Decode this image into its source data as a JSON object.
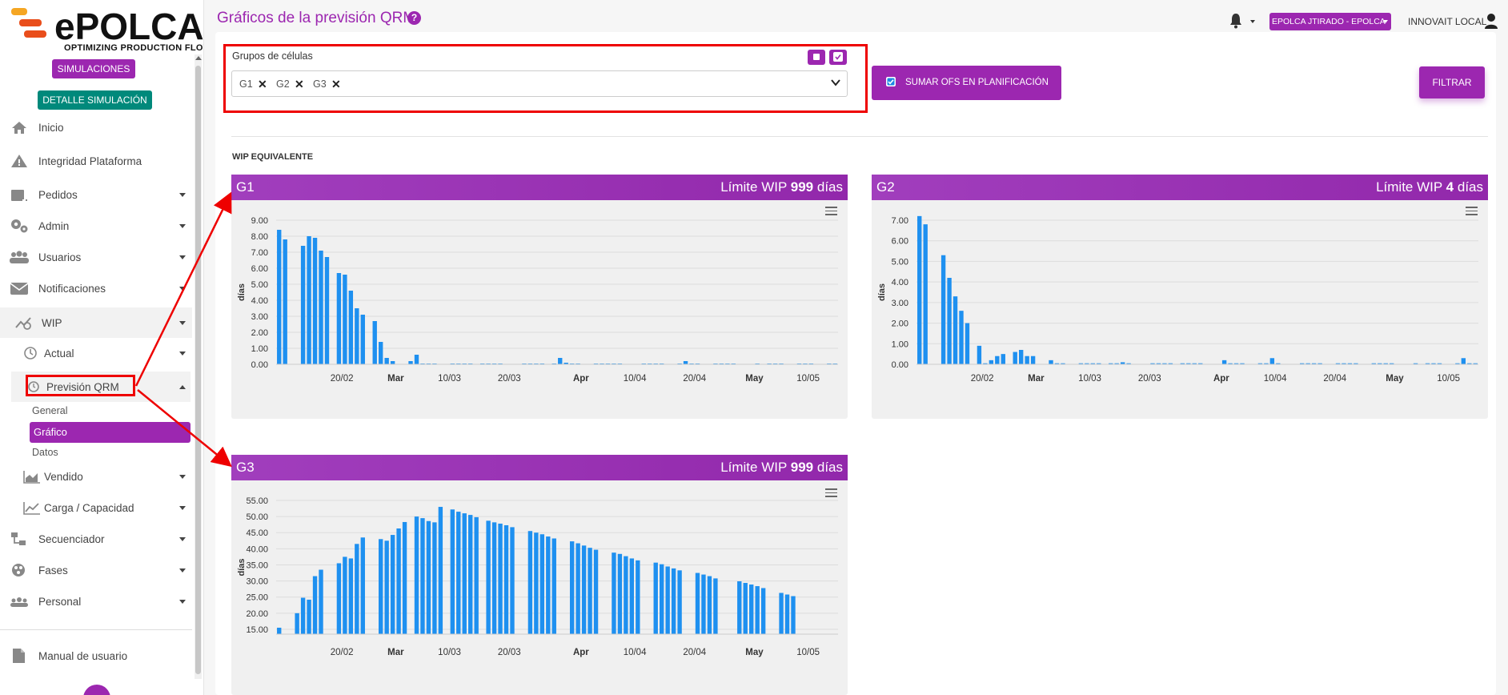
{
  "brand": {
    "name": "ePOLCA",
    "tagline": "OPTIMIZING PRODUCTION FLOW"
  },
  "sidebar": {
    "simulaciones_label": "SIMULACIONES",
    "detalle_label": "DETALLE SIMULACIÓN",
    "items": [
      {
        "label": "Inicio",
        "icon": "home-icon"
      },
      {
        "label": "Integridad Plataforma",
        "icon": "warning-icon"
      },
      {
        "label": "Pedidos",
        "icon": "orders-icon"
      },
      {
        "label": "Admin",
        "icon": "gears-icon"
      },
      {
        "label": "Usuarios",
        "icon": "users-icon"
      },
      {
        "label": "Notificaciones",
        "icon": "envelope-icon"
      },
      {
        "label": "WIP",
        "icon": "wip-icon"
      },
      {
        "label": "Actual",
        "icon": "clock-icon"
      },
      {
        "label": "Previsión QRM",
        "icon": "history-icon"
      },
      {
        "label": "Vendido",
        "icon": "area-chart-icon"
      },
      {
        "label": "Carga / Capacidad",
        "icon": "line-chart-icon"
      },
      {
        "label": "Secuenciador",
        "icon": "sequence-icon"
      },
      {
        "label": "Fases",
        "icon": "phases-icon"
      },
      {
        "label": "Personal",
        "icon": "people-icon"
      }
    ],
    "subitems": [
      "General",
      "Gráfico",
      "Datos"
    ],
    "manual_label": "Manual de usuario"
  },
  "header": {
    "title": "Gráficos de la previsión QRM",
    "help": "?",
    "company": "EPOLCA JTIRADO - EPOLCA",
    "user": "INNOVAIT LOCAL"
  },
  "filters": {
    "grupos_label": "Grupos de células",
    "tags": [
      "G1",
      "G2",
      "G3"
    ],
    "tag_remove": "✕",
    "sumar_label": "SUMAR OFS EN PLANIFICACIÓN",
    "sumar_checked": true,
    "filtrar_label": "FILTRAR"
  },
  "wip_section_title": "WIP EQUIVALENTE",
  "panels": [
    {
      "name": "G1",
      "limit_prefix": "Límite WIP",
      "limit_value": "999",
      "limit_suffix": "días"
    },
    {
      "name": "G2",
      "limit_prefix": "Límite WIP",
      "limit_value": "4",
      "limit_suffix": "días"
    },
    {
      "name": "G3",
      "limit_prefix": "Límite WIP",
      "limit_value": "999",
      "limit_suffix": "días"
    }
  ],
  "chart_data": [
    {
      "type": "bar",
      "title": "G1",
      "ylabel": "días",
      "ylim": [
        0,
        9
      ],
      "yticks": [
        "0.00",
        "1.00",
        "2.00",
        "3.00",
        "4.00",
        "5.00",
        "6.00",
        "7.00",
        "8.00",
        "9.00"
      ],
      "xticks": [
        {
          "label": "20/02",
          "day": 11,
          "bold": false
        },
        {
          "label": "Mar",
          "day": 20,
          "bold": true
        },
        {
          "label": "10/03",
          "day": 29,
          "bold": false
        },
        {
          "label": "20/03",
          "day": 39,
          "bold": false
        },
        {
          "label": "Apr",
          "day": 51,
          "bold": true
        },
        {
          "label": "10/04",
          "day": 60,
          "bold": false
        },
        {
          "label": "20/04",
          "day": 70,
          "bold": false
        },
        {
          "label": "May",
          "day": 80,
          "bold": true
        },
        {
          "label": "10/05",
          "day": 89,
          "bold": false
        }
      ],
      "days": 94,
      "values": [
        8.4,
        7.8,
        0,
        0,
        7.4,
        8,
        7.9,
        7.1,
        6.7,
        0,
        5.7,
        5.6,
        4.6,
        3.5,
        3.1,
        0,
        2.7,
        1.4,
        0.4,
        0.2,
        0,
        0,
        0.2,
        0.6,
        0.05,
        0.05,
        0.05,
        0,
        0,
        0.05,
        0.05,
        0.05,
        0.05,
        0,
        0.05,
        0.05,
        0.05,
        0.05,
        0,
        0,
        0,
        0.05,
        0.05,
        0.05,
        0.05,
        0,
        0.05,
        0.4,
        0.1,
        0.05,
        0.05,
        0,
        0,
        0.05,
        0.05,
        0.05,
        0.05,
        0.05,
        0,
        0,
        0,
        0.05,
        0.05,
        0.05,
        0.05,
        0,
        0,
        0.05,
        0.2,
        0.05,
        0.05,
        0,
        0,
        0.05,
        0.05,
        0.05,
        0.05,
        0,
        0,
        0,
        0.05,
        0,
        0.05,
        0.05,
        0.05,
        0,
        0,
        0.05,
        0.05,
        0.05,
        0,
        0,
        0.05,
        0.05
      ]
    },
    {
      "type": "bar",
      "title": "G2",
      "ylabel": "días",
      "ylim": [
        0,
        7
      ],
      "yticks": [
        "0.00",
        "1.00",
        "2.00",
        "3.00",
        "4.00",
        "5.00",
        "6.00",
        "7.00"
      ],
      "xticks": [
        {
          "label": "20/02",
          "day": 11,
          "bold": false
        },
        {
          "label": "Mar",
          "day": 20,
          "bold": true
        },
        {
          "label": "10/03",
          "day": 29,
          "bold": false
        },
        {
          "label": "20/03",
          "day": 39,
          "bold": false
        },
        {
          "label": "Apr",
          "day": 51,
          "bold": true
        },
        {
          "label": "10/04",
          "day": 60,
          "bold": false
        },
        {
          "label": "20/04",
          "day": 70,
          "bold": false
        },
        {
          "label": "May",
          "day": 80,
          "bold": true
        },
        {
          "label": "10/05",
          "day": 89,
          "bold": false
        }
      ],
      "days": 94,
      "values": [
        7.2,
        6.8,
        0,
        0,
        5.3,
        4.2,
        3.3,
        2.6,
        2,
        0,
        0.9,
        0.05,
        0.2,
        0.4,
        0.5,
        0,
        0.6,
        0.7,
        0.4,
        0.4,
        0,
        0,
        0.2,
        0.05,
        0.05,
        0,
        0,
        0.05,
        0.05,
        0.05,
        0.05,
        0,
        0.05,
        0.05,
        0.1,
        0.05,
        0,
        0,
        0,
        0.05,
        0.05,
        0.05,
        0.05,
        0,
        0.05,
        0.05,
        0.05,
        0.05,
        0,
        0,
        0,
        0.2,
        0.05,
        0.05,
        0.05,
        0,
        0,
        0.05,
        0.05,
        0.3,
        0.05,
        0,
        0,
        0,
        0.05,
        0.05,
        0.05,
        0.05,
        0,
        0,
        0.05,
        0.05,
        0.05,
        0.05,
        0,
        0,
        0.05,
        0.05,
        0.05,
        0.05,
        0,
        0,
        0,
        0.05,
        0,
        0.05,
        0.05,
        0.05,
        0,
        0,
        0.05,
        0.3,
        0.05,
        0.05
      ]
    },
    {
      "type": "bar",
      "title": "G3",
      "ylabel": "días",
      "ylim": [
        13.5,
        55
      ],
      "yticks": [
        "15.00",
        "20.00",
        "25.00",
        "30.00",
        "35.00",
        "40.00",
        "45.00",
        "50.00",
        "55.00"
      ],
      "ytick_values": [
        15,
        20,
        25,
        30,
        35,
        40,
        45,
        50,
        55
      ],
      "xticks": [
        {
          "label": "20/02",
          "day": 11,
          "bold": false
        },
        {
          "label": "Mar",
          "day": 20,
          "bold": true
        },
        {
          "label": "10/03",
          "day": 29,
          "bold": false
        },
        {
          "label": "20/03",
          "day": 39,
          "bold": false
        },
        {
          "label": "Apr",
          "day": 51,
          "bold": true
        },
        {
          "label": "10/04",
          "day": 60,
          "bold": false
        },
        {
          "label": "20/04",
          "day": 70,
          "bold": false
        },
        {
          "label": "May",
          "day": 80,
          "bold": true
        },
        {
          "label": "10/05",
          "day": 89,
          "bold": false
        }
      ],
      "days": 94,
      "values": [
        15.5,
        0,
        0,
        20,
        24.8,
        24.2,
        31.5,
        33.5,
        0,
        0,
        35.5,
        37.5,
        37,
        41.5,
        43.5,
        0,
        0,
        43,
        42.5,
        44.3,
        46.3,
        48.3,
        0,
        50,
        49.5,
        48.6,
        48.2,
        53,
        0,
        52.2,
        51.5,
        51,
        50.5,
        49.8,
        0,
        48.7,
        48.2,
        47.8,
        47.3,
        46.7,
        0,
        0,
        45.5,
        45,
        44.5,
        43.8,
        43.2,
        0,
        0,
        42.3,
        41.7,
        41,
        40.3,
        39.7,
        0,
        0,
        38.8,
        38.4,
        37.7,
        37,
        36.4,
        0,
        0,
        35.7,
        35.2,
        34.5,
        33.9,
        33.3,
        0,
        0,
        32.5,
        32,
        31.5,
        30.8,
        0,
        0,
        0,
        29.9,
        29.4,
        28.9,
        28.4,
        27.8,
        0,
        0,
        26.3,
        25.8,
        25.3,
        0,
        0,
        0,
        0,
        0,
        0,
        0
      ]
    }
  ]
}
